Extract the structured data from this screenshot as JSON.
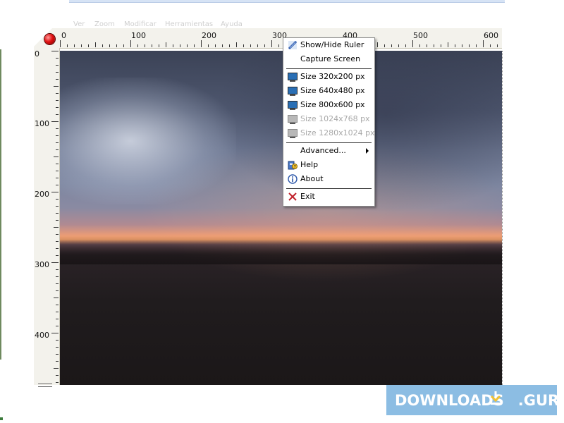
{
  "background_app": {
    "menu_items": [
      "Ver",
      "Zoom",
      "Modificar",
      "Herramientas",
      "Ayuda"
    ]
  },
  "ruler": {
    "top_labels": [
      "0",
      "100",
      "200",
      "300",
      "400",
      "500",
      "600"
    ],
    "left_labels": [
      "0",
      "100",
      "200",
      "300",
      "400"
    ]
  },
  "context_menu": {
    "items": [
      {
        "label": "Show/Hide Ruler",
        "icon": "ruler-icon",
        "enabled": true
      },
      {
        "label": "Capture Screen",
        "icon": "",
        "enabled": true
      },
      {
        "label": "Size 320x200 px",
        "icon": "monitor-icon",
        "enabled": true
      },
      {
        "label": "Size 640x480 px",
        "icon": "monitor-icon",
        "enabled": true
      },
      {
        "label": "Size 800x600 px",
        "icon": "monitor-icon",
        "enabled": true
      },
      {
        "label": "Size 1024x768 px",
        "icon": "monitor-icon",
        "enabled": false
      },
      {
        "label": "Size 1280x1024 px",
        "icon": "monitor-icon",
        "enabled": false
      },
      {
        "label": "Advanced...",
        "icon": "",
        "enabled": true,
        "submenu": true
      },
      {
        "label": "Help",
        "icon": "help-icon",
        "enabled": true
      },
      {
        "label": "About",
        "icon": "info-icon",
        "enabled": true
      },
      {
        "label": "Exit",
        "icon": "close-icon",
        "enabled": true
      }
    ]
  },
  "watermark": {
    "text": "DOWNLOADS",
    "suffix": ".GURU"
  },
  "colors": {
    "watermark_bg": "#8cbde3",
    "monitor_icon": "#2a6fb5",
    "record_button": "#e01010"
  }
}
